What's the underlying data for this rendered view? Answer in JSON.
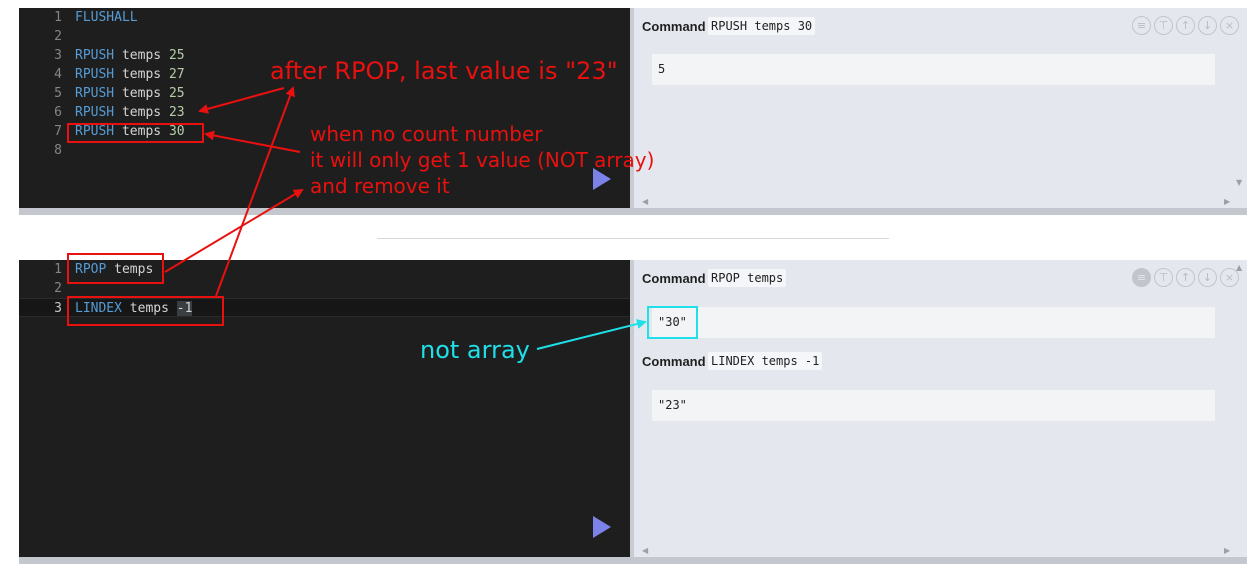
{
  "panel1": {
    "editor_lines": [
      {
        "n": "1",
        "kw": "FLUSHALL",
        "rest": "",
        "num": ""
      },
      {
        "n": "2",
        "kw": "",
        "rest": "",
        "num": ""
      },
      {
        "n": "3",
        "kw": "RPUSH",
        "rest": " temps ",
        "num": "25"
      },
      {
        "n": "4",
        "kw": "RPUSH",
        "rest": " temps ",
        "num": "27"
      },
      {
        "n": "5",
        "kw": "RPUSH",
        "rest": " temps ",
        "num": "25"
      },
      {
        "n": "6",
        "kw": "RPUSH",
        "rest": " temps ",
        "num": "23"
      },
      {
        "n": "7",
        "kw": "RPUSH",
        "rest": " temps ",
        "num": "30"
      },
      {
        "n": "8",
        "kw": "",
        "rest": "",
        "num": ""
      }
    ],
    "result": {
      "command_label": "Command",
      "command": "RPUSH temps 30",
      "output": "5"
    }
  },
  "panel2": {
    "editor_lines": [
      {
        "n": "1",
        "kw": "RPOP",
        "rest": " temps",
        "num": ""
      },
      {
        "n": "2",
        "kw": "",
        "rest": "",
        "num": ""
      },
      {
        "n": "3",
        "kw": "LINDEX",
        "rest": " temps ",
        "num": "-1"
      }
    ],
    "results": [
      {
        "command_label": "Command",
        "command": "RPOP temps",
        "output": "\"30\""
      },
      {
        "command_label": "Command",
        "command": "LINDEX temps -1",
        "output": "\"23\""
      }
    ]
  },
  "toolbar_icons": [
    "list-icon",
    "format-icon",
    "arrow-up-icon",
    "arrow-down-icon",
    "close-icon"
  ],
  "annotations": {
    "after_rpop": "after RPOP, last value is \"23\"",
    "no_count_1": "when no count number",
    "no_count_2": "it will only get 1 value (NOT array)",
    "no_count_3": "and remove it",
    "not_array": "not array"
  },
  "colors": {
    "annotation_red": "#e8110f",
    "annotation_cyan": "#1fe0e8",
    "keyword": "#569cd6",
    "number": "#b5cea8",
    "run_button": "#7b83e8"
  }
}
